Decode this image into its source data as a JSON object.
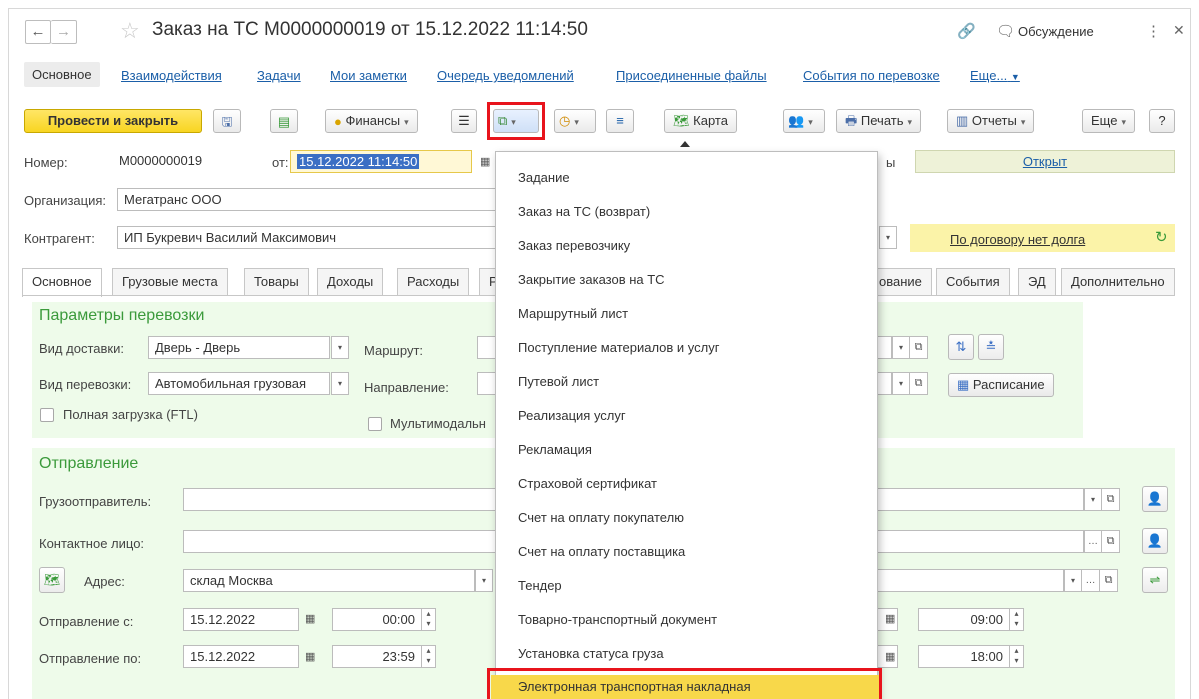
{
  "window": {
    "title": "Заказ на ТС М0000000019 от 15.12.2022 11:14:50",
    "discuss_label": "Обсуждение"
  },
  "sections": [
    "Основное",
    "Взаимодействия",
    "Задачи",
    "Мои заметки",
    "Очередь уведомлений",
    "Присоединенные файлы",
    "События по перевозке",
    "Еще..."
  ],
  "toolbar": {
    "post_close": "Провести и закрыть",
    "finance": "Финансы",
    "map": "Карта",
    "print": "Печать",
    "reports": "Отчеты",
    "more": "Еще",
    "help": "?"
  },
  "fields": {
    "number_label": "Номер:",
    "number_value": "М0000000019",
    "from_label": "от:",
    "date_value": "15.12.2022 11:14:50",
    "org_label": "Организация:",
    "org_value": "Мегатранс ООО",
    "contractor_label": "Контрагент:",
    "contractor_value": "ИП Букревич Василий Максимович",
    "status_fragment": "ы",
    "status_value": "Открыт",
    "debt_text": "По договору нет долга"
  },
  "tabs": [
    "Основное",
    "Грузовые места",
    "Товары",
    "Доходы",
    "Расходы",
    "Р",
    "ование",
    "События",
    "ЭД",
    "Дополнительно"
  ],
  "transport": {
    "title": "Параметры перевозки",
    "delivery_label": "Вид доставки:",
    "delivery_value": "Дверь - Дверь",
    "route_label": "Маршрут:",
    "transport_label": "Вид перевозки:",
    "transport_value": "Автомобильная грузовая",
    "direction_label": "Направление:",
    "ftl_label": "Полная загрузка (FTL)",
    "multimodal_label": "Мультимодальн",
    "schedule_label": "Расписание"
  },
  "shipment": {
    "title": "Отправление",
    "shipper_label": "Грузоотправитель:",
    "contact_label": "Контактное лицо:",
    "address_label": "Адрес:",
    "address_value": "склад Москва",
    "from_label": "Отправление с:",
    "from_date": "15.12.2022",
    "from_time": "00:00",
    "to_label": "Отправление по:",
    "to_date": "15.12.2022",
    "to_time": "23:59",
    "right_time1": "09:00",
    "right_time2": "18:00"
  },
  "menu_items": [
    "Задание",
    "Заказ на ТС (возврат)",
    "Заказ перевозчику",
    "Закрытие заказов на ТС",
    "Маршрутный лист",
    "Поступление материалов и услуг",
    "Путевой лист",
    "Реализация услуг",
    "Рекламация",
    "Страховой сертификат",
    "Счет на оплату покупателю",
    "Счет на оплату поставщика",
    "Тендер",
    "Товарно-транспортный документ",
    "Установка статуса груза",
    "Электронная транспортная накладная"
  ],
  "colors": {
    "accent_yellow": "#f8d521",
    "highlight_red": "#e8141c",
    "group_green": "#3b9a3b",
    "link_blue": "#1b5fa8"
  }
}
